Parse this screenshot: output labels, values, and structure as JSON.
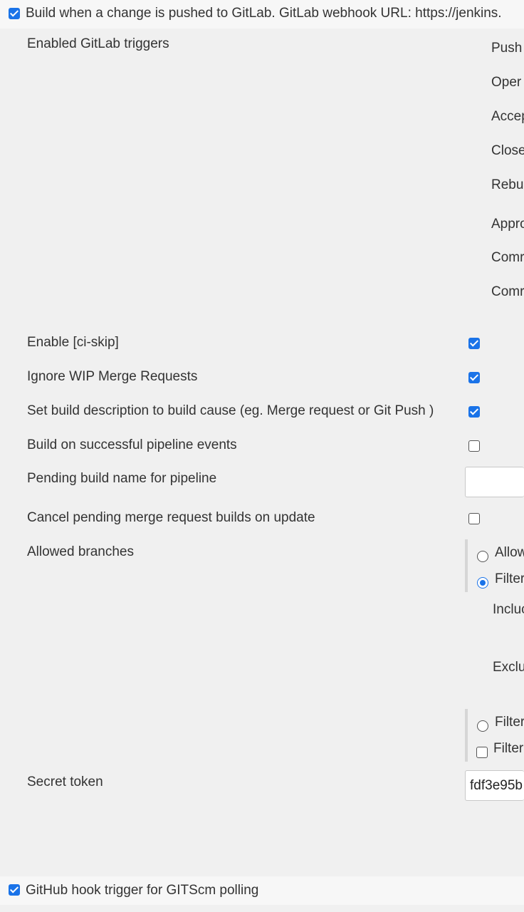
{
  "top_trigger": {
    "label": "Build when a change is pushed to GitLab. GitLab webhook URL: https://jenkins.",
    "checked": true
  },
  "enabled_triggers": {
    "heading": "Enabled GitLab triggers",
    "items": [
      "Push",
      "Oper",
      "Accep",
      "Close",
      "Rebu",
      "Appro",
      "Comr",
      "Comr"
    ]
  },
  "options": [
    {
      "label": "Enable [ci-skip]",
      "checked": true
    },
    {
      "label": "Ignore WIP Merge Requests",
      "checked": true
    },
    {
      "label": "Set build description to build cause (eg. Merge request or Git Push )",
      "checked": true
    },
    {
      "label": "Build on successful pipeline events",
      "checked": false
    }
  ],
  "pending_build": {
    "label": "Pending build name for pipeline",
    "value": ""
  },
  "cancel_pending": {
    "label": "Cancel pending merge request builds on update",
    "checked": false
  },
  "allowed_branches": {
    "label": "Allowed branches",
    "radio_allow": "Allow",
    "radio_filter": "Filter",
    "include_label": "Incluc",
    "exclude_label": "Exclu",
    "radio_filter2": "Filter",
    "checkbox_filter": "Filter"
  },
  "secret_token": {
    "label": "Secret token",
    "value": "fdf3e95b"
  },
  "github_trigger": {
    "label": "GitHub hook trigger for GITScm polling",
    "checked": true
  }
}
